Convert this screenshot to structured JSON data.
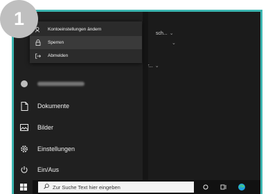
{
  "step_badge": "1",
  "popup": {
    "items": [
      {
        "label": "Kontoeinstellungen ändern",
        "icon": "account-settings-icon"
      },
      {
        "label": "Sperren",
        "icon": "lock-icon"
      },
      {
        "label": "Abmelden",
        "icon": "sign-out-icon"
      }
    ]
  },
  "start_menu": {
    "documents": "Dokumente",
    "pictures": "Bilder",
    "settings": "Einstellungen",
    "power": "Ein/Aus"
  },
  "tiles": {
    "label_1": "sch...",
    "label_2": "istr..."
  },
  "taskbar": {
    "search_placeholder": "Zur Suche Text hier eingeben"
  },
  "colors": {
    "accent_border": "#3bb5b0",
    "edge_browser": "#1fa0e0"
  }
}
